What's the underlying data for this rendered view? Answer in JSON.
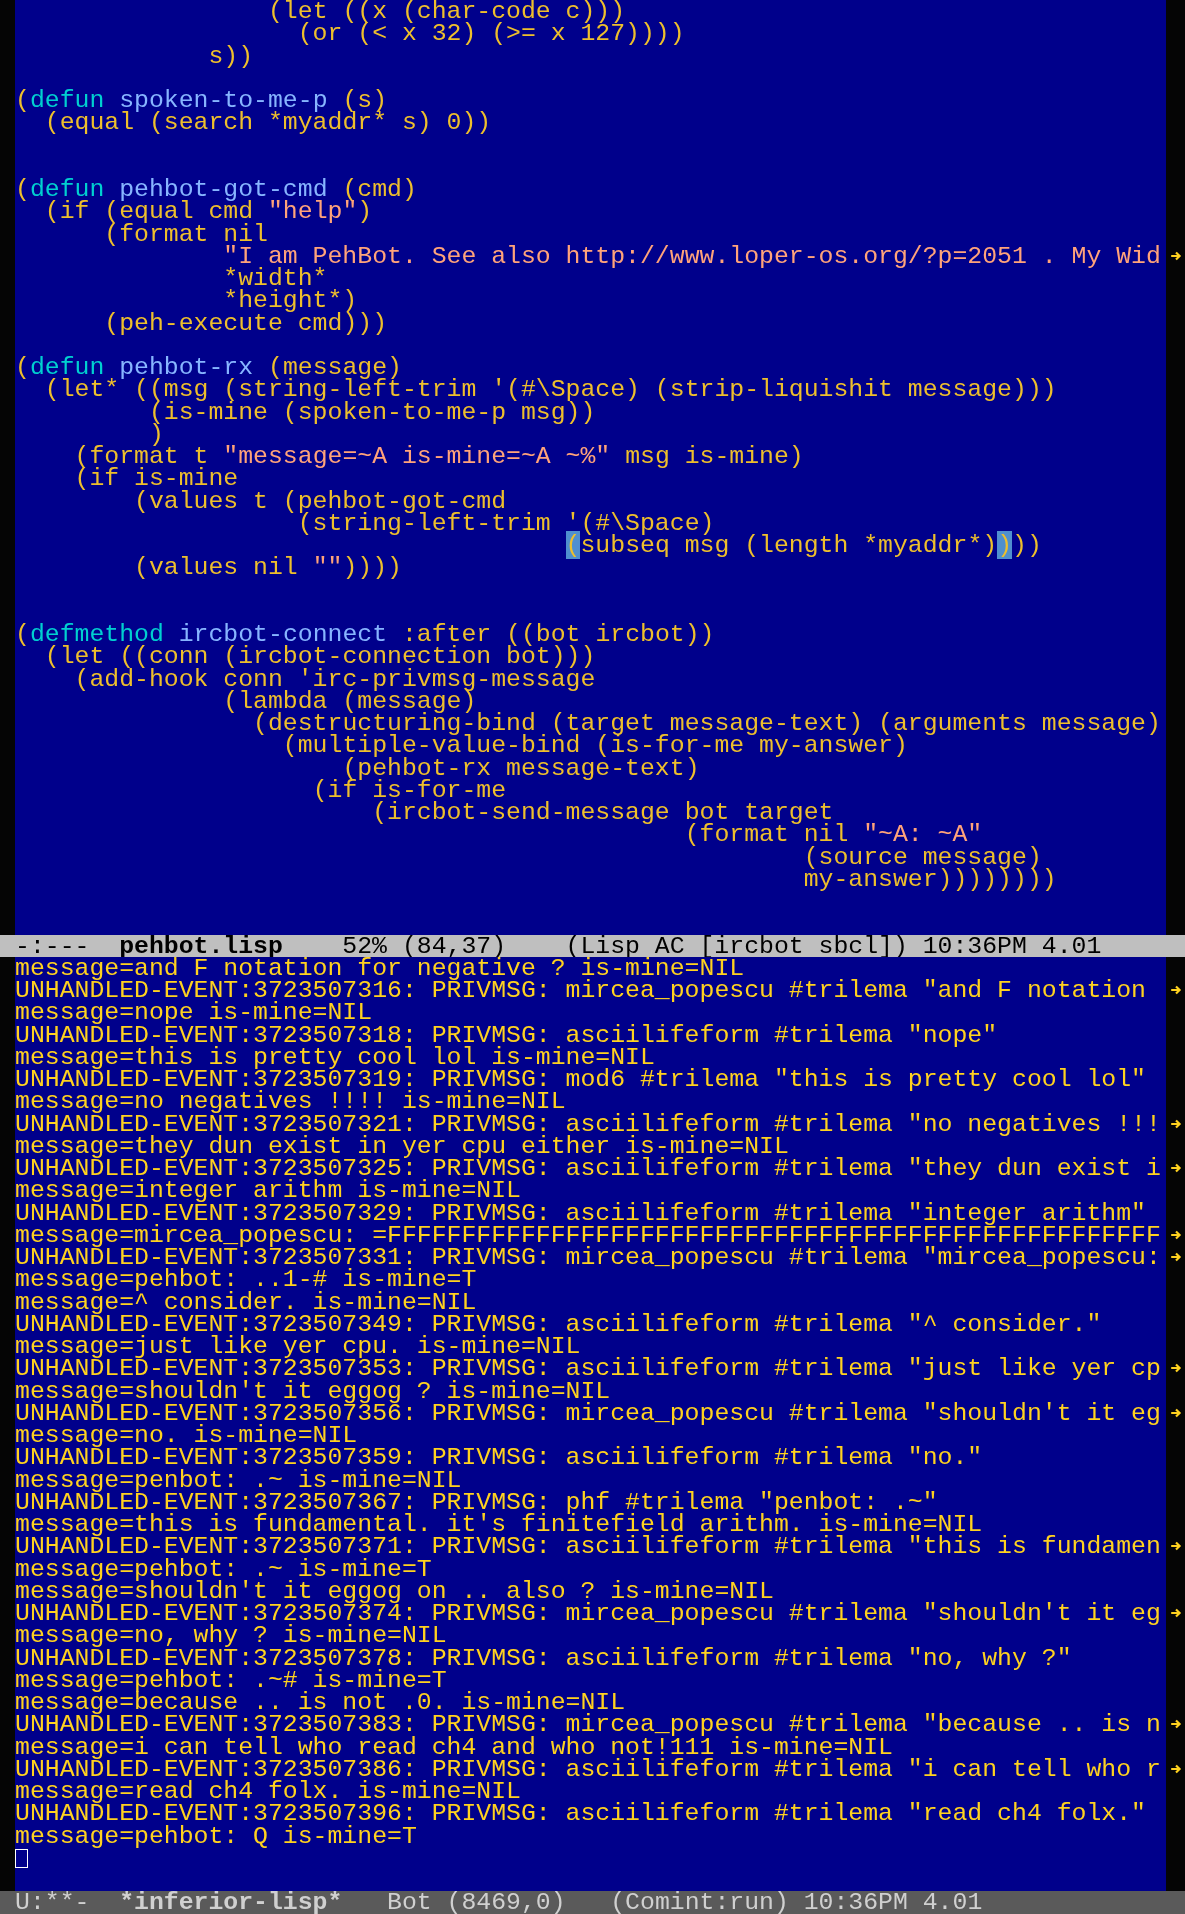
{
  "editor": {
    "lines": [
      {
        "kind": "code",
        "segments": [
          {
            "text": "                 (let ((x (char-code c)))",
            "kind": "plain"
          }
        ]
      },
      {
        "kind": "code",
        "segments": [
          {
            "text": "                   (or (< x 32) (>= x 127))))",
            "kind": "plain"
          }
        ]
      },
      {
        "kind": "code",
        "segments": [
          {
            "text": "             s))",
            "kind": "plain"
          }
        ]
      },
      {
        "kind": "blank"
      },
      {
        "kind": "code",
        "segments": [
          {
            "text": "(",
            "kind": "plain"
          },
          {
            "text": "defun",
            "kind": "keyword"
          },
          {
            "text": " spoken-to-me-p",
            "kind": "function"
          },
          {
            "text": " (s)",
            "kind": "plain"
          }
        ]
      },
      {
        "kind": "code",
        "segments": [
          {
            "text": "  (equal (search *myaddr* s) 0))",
            "kind": "plain"
          }
        ]
      },
      {
        "kind": "blank"
      },
      {
        "kind": "blank"
      },
      {
        "kind": "code",
        "segments": [
          {
            "text": "(",
            "kind": "plain"
          },
          {
            "text": "defun",
            "kind": "keyword"
          },
          {
            "text": " pehbot-got-cmd",
            "kind": "function"
          },
          {
            "text": " (cmd)",
            "kind": "plain"
          }
        ]
      },
      {
        "kind": "code",
        "segments": [
          {
            "text": "  (if (equal cmd ",
            "kind": "plain"
          },
          {
            "text": "\"help\"",
            "kind": "string"
          },
          {
            "text": ")",
            "kind": "plain"
          }
        ]
      },
      {
        "kind": "code",
        "segments": [
          {
            "text": "      (format nil",
            "kind": "plain"
          }
        ]
      },
      {
        "kind": "code",
        "continued": true,
        "segments": [
          {
            "text": "              \"I am PehBot. See also http://www.loper-os.org/?p=2051 . My Wid",
            "kind": "string"
          }
        ]
      },
      {
        "kind": "code",
        "segments": [
          {
            "text": "              *width*",
            "kind": "plain"
          }
        ]
      },
      {
        "kind": "code",
        "segments": [
          {
            "text": "              *height*)",
            "kind": "plain"
          }
        ]
      },
      {
        "kind": "code",
        "segments": [
          {
            "text": "      (peh-execute cmd)))",
            "kind": "plain"
          }
        ]
      },
      {
        "kind": "blank"
      },
      {
        "kind": "code",
        "segments": [
          {
            "text": "(",
            "kind": "plain"
          },
          {
            "text": "defun",
            "kind": "keyword"
          },
          {
            "text": " pehbot-rx",
            "kind": "function"
          },
          {
            "text": " (message)",
            "kind": "plain"
          }
        ]
      },
      {
        "kind": "code",
        "segments": [
          {
            "text": "  (let* ((msg (string-left-trim '(#\\Space) (strip-liquishit message)))",
            "kind": "plain"
          }
        ]
      },
      {
        "kind": "code",
        "segments": [
          {
            "text": "         (is-mine (spoken-to-me-p msg))",
            "kind": "plain"
          }
        ]
      },
      {
        "kind": "code",
        "segments": [
          {
            "text": "         )",
            "kind": "plain"
          }
        ]
      },
      {
        "kind": "code",
        "segments": [
          {
            "text": "    (format t ",
            "kind": "plain"
          },
          {
            "text": "\"message=~A is-mine=~A ~%\"",
            "kind": "string"
          },
          {
            "text": " msg is-mine)",
            "kind": "plain"
          }
        ]
      },
      {
        "kind": "code",
        "segments": [
          {
            "text": "    (if is-mine",
            "kind": "plain"
          }
        ]
      },
      {
        "kind": "code",
        "segments": [
          {
            "text": "        (values t (pehbot-got-cmd",
            "kind": "plain"
          }
        ]
      },
      {
        "kind": "code",
        "segments": [
          {
            "text": "                   (string-left-trim '(#\\Space)",
            "kind": "plain"
          }
        ]
      },
      {
        "kind": "code",
        "segments": [
          {
            "text": "                                     (",
            "kind": "paren-match"
          },
          {
            "text": "subseq msg (length *myaddr*)",
            "kind": "plain"
          },
          {
            "text": ")",
            "kind": "paren-match"
          },
          {
            "text": "))",
            "kind": "plain"
          }
        ]
      },
      {
        "kind": "code",
        "segments": [
          {
            "text": "        (values nil ",
            "kind": "plain"
          },
          {
            "text": "\"\"",
            "kind": "string"
          },
          {
            "text": "))))",
            "kind": "plain"
          }
        ]
      },
      {
        "kind": "blank"
      },
      {
        "kind": "blank"
      },
      {
        "kind": "code",
        "segments": [
          {
            "text": "(",
            "kind": "plain"
          },
          {
            "text": "defmethod",
            "kind": "keyword"
          },
          {
            "text": " ircbot-connect",
            "kind": "function"
          },
          {
            "text": " :after ((bot ircbot))",
            "kind": "plain"
          }
        ]
      },
      {
        "kind": "code",
        "segments": [
          {
            "text": "  (let ((conn (ircbot-connection bot)))",
            "kind": "plain"
          }
        ]
      },
      {
        "kind": "code",
        "segments": [
          {
            "text": "    (add-hook conn 'irc-privmsg-message",
            "kind": "plain"
          }
        ]
      },
      {
        "kind": "code",
        "segments": [
          {
            "text": "              (lambda (message)",
            "kind": "plain"
          }
        ]
      },
      {
        "kind": "code",
        "segments": [
          {
            "text": "                (destructuring-bind (target message-text) (arguments message)",
            "kind": "plain"
          }
        ]
      },
      {
        "kind": "code",
        "segments": [
          {
            "text": "                  (multiple-value-bind (is-for-me my-answer)",
            "kind": "plain"
          }
        ]
      },
      {
        "kind": "code",
        "segments": [
          {
            "text": "                      (pehbot-rx message-text)",
            "kind": "plain"
          }
        ]
      },
      {
        "kind": "code",
        "segments": [
          {
            "text": "                    (if is-for-me",
            "kind": "plain"
          }
        ]
      },
      {
        "kind": "code",
        "segments": [
          {
            "text": "                        (ircbot-send-message bot target",
            "kind": "plain"
          }
        ]
      },
      {
        "kind": "code",
        "segments": [
          {
            "text": "                                             (format nil ",
            "kind": "plain"
          },
          {
            "text": "\"~A: ~A\"",
            "kind": "string"
          }
        ]
      },
      {
        "kind": "code",
        "segments": [
          {
            "text": "                                                     (source message)",
            "kind": "plain"
          }
        ]
      },
      {
        "kind": "code",
        "segments": [
          {
            "text": "                                                     my-answer))))))))",
            "kind": "plain"
          }
        ]
      },
      {
        "kind": "blank"
      },
      {
        "kind": "blank"
      }
    ],
    "mode_line": {
      "active": true,
      "status": "-:---",
      "buffer": "pehbot.lisp",
      "position": "52% (84,37)",
      "modes": "(Lisp AC [ircbot sbcl])",
      "time": "10:36PM",
      "load": "4.01"
    }
  },
  "repl": {
    "lines": [
      {
        "kind": "output",
        "text": "message=and F notation for negative ? is-mine=NIL"
      },
      {
        "kind": "output",
        "continued": true,
        "text": "UNHANDLED-EVENT:3723507316: PRIVMSG: mircea_popescu #trilema \"and F notation"
      },
      {
        "kind": "output",
        "text": "message=nope is-mine=NIL"
      },
      {
        "kind": "output",
        "text": "UNHANDLED-EVENT:3723507318: PRIVMSG: asciilifeform #trilema \"nope\""
      },
      {
        "kind": "output",
        "text": "message=this is pretty cool lol is-mine=NIL"
      },
      {
        "kind": "output",
        "text": "UNHANDLED-EVENT:3723507319: PRIVMSG: mod6 #trilema \"this is pretty cool lol\""
      },
      {
        "kind": "output",
        "text": "message=no negatives !!!! is-mine=NIL"
      },
      {
        "kind": "output",
        "continued": true,
        "text": "UNHANDLED-EVENT:3723507321: PRIVMSG: asciilifeform #trilema \"no negatives !!!"
      },
      {
        "kind": "output",
        "text": "message=they dun exist in yer cpu either is-mine=NIL"
      },
      {
        "kind": "output",
        "continued": true,
        "text": "UNHANDLED-EVENT:3723507325: PRIVMSG: asciilifeform #trilema \"they dun exist i"
      },
      {
        "kind": "output",
        "text": "message=integer arithm is-mine=NIL"
      },
      {
        "kind": "output",
        "text": "UNHANDLED-EVENT:3723507329: PRIVMSG: asciilifeform #trilema \"integer arithm\""
      },
      {
        "kind": "output",
        "continued": true,
        "text": "message=mircea_popescu: =FFFFFFFFFFFFFFFFFFFFFFFFFFFFFFFFFFFFFFFFFFFFFFFFFFFF"
      },
      {
        "kind": "output",
        "continued": true,
        "text": "UNHANDLED-EVENT:3723507331: PRIVMSG: mircea_popescu #trilema \"mircea_popescu:"
      },
      {
        "kind": "output",
        "text": "message=pehbot: ..1-# is-mine=T"
      },
      {
        "kind": "output",
        "text": "message=^ consider. is-mine=NIL"
      },
      {
        "kind": "output",
        "text": "UNHANDLED-EVENT:3723507349: PRIVMSG: asciilifeform #trilema \"^ consider.\""
      },
      {
        "kind": "output",
        "text": "message=just like yer cpu. is-mine=NIL"
      },
      {
        "kind": "output",
        "continued": true,
        "text": "UNHANDLED-EVENT:3723507353: PRIVMSG: asciilifeform #trilema \"just like yer cp"
      },
      {
        "kind": "output",
        "text": "message=shouldn't it eggog ? is-mine=NIL"
      },
      {
        "kind": "output",
        "continued": true,
        "text": "UNHANDLED-EVENT:3723507356: PRIVMSG: mircea_popescu #trilema \"shouldn't it eg"
      },
      {
        "kind": "output",
        "text": "message=no. is-mine=NIL"
      },
      {
        "kind": "output",
        "text": "UNHANDLED-EVENT:3723507359: PRIVMSG: asciilifeform #trilema \"no.\""
      },
      {
        "kind": "output",
        "text": "message=penbot: .~ is-mine=NIL"
      },
      {
        "kind": "output",
        "text": "UNHANDLED-EVENT:3723507367: PRIVMSG: phf #trilema \"penbot: .~\""
      },
      {
        "kind": "output",
        "text": "message=this is fundamental. it's finitefield arithm. is-mine=NIL"
      },
      {
        "kind": "output",
        "continued": true,
        "text": "UNHANDLED-EVENT:3723507371: PRIVMSG: asciilifeform #trilema \"this is fundamen"
      },
      {
        "kind": "output",
        "text": "message=pehbot: .~ is-mine=T"
      },
      {
        "kind": "output",
        "text": "message=shouldn't it eggog on .. also ? is-mine=NIL"
      },
      {
        "kind": "output",
        "continued": true,
        "text": "UNHANDLED-EVENT:3723507374: PRIVMSG: mircea_popescu #trilema \"shouldn't it eg"
      },
      {
        "kind": "output",
        "text": "message=no, why ? is-mine=NIL"
      },
      {
        "kind": "output",
        "text": "UNHANDLED-EVENT:3723507378: PRIVMSG: asciilifeform #trilema \"no, why ?\""
      },
      {
        "kind": "output",
        "text": "message=pehbot: .~# is-mine=T"
      },
      {
        "kind": "output",
        "text": "message=because .. is not .0. is-mine=NIL"
      },
      {
        "kind": "output",
        "continued": true,
        "text": "UNHANDLED-EVENT:3723507383: PRIVMSG: mircea_popescu #trilema \"because .. is n"
      },
      {
        "kind": "output",
        "text": "message=i can tell who read ch4 and who not!111 is-mine=NIL"
      },
      {
        "kind": "output",
        "continued": true,
        "text": "UNHANDLED-EVENT:3723507386: PRIVMSG: asciilifeform #trilema \"i can tell who r"
      },
      {
        "kind": "output",
        "text": "message=read ch4 folx. is-mine=NIL"
      },
      {
        "kind": "output",
        "text": "UNHANDLED-EVENT:3723507396: PRIVMSG: asciilifeform #trilema \"read ch4 folx.\""
      },
      {
        "kind": "output",
        "text": "message=pehbot: Q is-mine=T"
      },
      {
        "kind": "cursor"
      },
      {
        "kind": "blank"
      }
    ],
    "mode_line": {
      "active": false,
      "status": "U:**-",
      "buffer": "*inferior-lisp*",
      "position": "Bot (8469,0)",
      "modes": "(Comint:run)",
      "time": "10:36PM",
      "load": "4.01"
    }
  }
}
